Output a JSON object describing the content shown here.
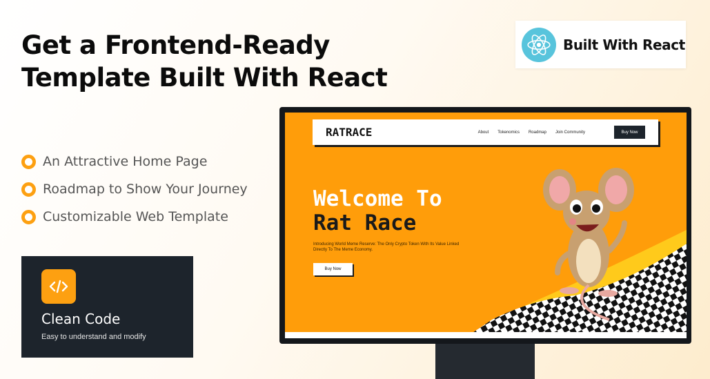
{
  "headline": {
    "line1": "Get a Frontend-Ready",
    "line2": "Template Built With React"
  },
  "badge": {
    "label": "Built With React",
    "icon": "react-atom-icon",
    "icon_color": "#58C4DC"
  },
  "features": [
    {
      "label": "An Attractive Home Page"
    },
    {
      "label": "Roadmap to Show Your Journey"
    },
    {
      "label": "Customizable Web Template"
    }
  ],
  "clean_code": {
    "title": "Clean Code",
    "subtitle": "Easy to understand and modify",
    "icon": "code-icon"
  },
  "site": {
    "brand": "RATRACE",
    "nav": [
      "About",
      "Tokenomics",
      "Roadmap",
      "Join Community"
    ],
    "nav_button": "Buy Now",
    "hero_line1": "Welcome To",
    "hero_line2": "Rat Race",
    "hero_subtitle": "Introducing World Meme Reserve: The Only Crypto Token With Its Value Linked Directly To The Meme Economy.",
    "hero_button": "Buy Now"
  },
  "colors": {
    "accent_orange": "#FDA011",
    "screen_bg": "#FF9D0A",
    "dark": "#1D242C"
  }
}
